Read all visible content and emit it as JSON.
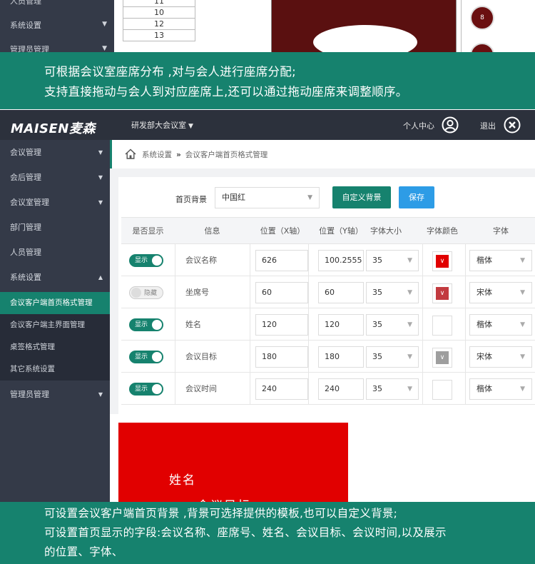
{
  "top_strip": {
    "sidebar_items": [
      {
        "label": "人员管理",
        "has_arrow": false
      },
      {
        "label": "系统设置",
        "has_arrow": true
      },
      {
        "label": "管理员管理",
        "has_arrow": true
      }
    ],
    "seat_numbers": [
      "11",
      "10",
      "12",
      "13"
    ],
    "seats": [
      "8",
      ""
    ]
  },
  "caption_top": [
    "可根据会议室座席分布 ,对与会人进行座席分配;",
    "支持直接拖动与会人到对应座席上,还可以通过拖动座席来调整顺序。"
  ],
  "caption_bottom": [
    "可设置会议客户端首页背景 ,背景可选择提供的模板,也可以自定义背景;",
    "可设置首页显示的字段:会议名称、座席号、姓名、会议目标、会议时间,以及展示",
    "的位置、字体、"
  ],
  "header": {
    "logo": "MAISEN麦森",
    "room_select": "研发部大会议室",
    "personal_center": "个人中心",
    "logout": "退出"
  },
  "sidebar": {
    "items": [
      {
        "label": "会议管理",
        "arrow": "▼"
      },
      {
        "label": "会后管理",
        "arrow": "▼"
      },
      {
        "label": "会议室管理",
        "arrow": "▼"
      },
      {
        "label": "部门管理",
        "arrow": ""
      },
      {
        "label": "人员管理",
        "arrow": ""
      },
      {
        "label": "系统设置",
        "arrow": "▲"
      }
    ],
    "subitems": [
      {
        "label": "会议客户端首页格式管理",
        "active": true
      },
      {
        "label": "会议客户端主界面管理",
        "active": false
      },
      {
        "label": "桌签格式管理",
        "active": false
      },
      {
        "label": "其它系统设置",
        "active": false
      }
    ],
    "last_item": {
      "label": "管理员管理",
      "arrow": "▼"
    }
  },
  "breadcrumb": {
    "root": "系统设置",
    "separator": "»",
    "current": "会议客户端首页格式管理"
  },
  "controls": {
    "bg_label": "首页背景",
    "bg_value": "中国红",
    "custom_bg_button": "自定义背景",
    "save_button": "保存"
  },
  "table": {
    "headers": [
      "是否显示",
      "信息",
      "位置（X轴）",
      "位置（Y轴）",
      "字体大小",
      "字体颜色",
      "字体"
    ],
    "rows": [
      {
        "show": true,
        "toggle_label": "显示",
        "info": "会议名称",
        "x": "626",
        "y": "100.2555",
        "size": "35",
        "color": "#e10000",
        "font": "楷体"
      },
      {
        "show": false,
        "toggle_label": "隐藏",
        "info": "坐席号",
        "x": "60",
        "y": "60",
        "size": "35",
        "color": "#c23a3f",
        "font": "宋体"
      },
      {
        "show": true,
        "toggle_label": "显示",
        "info": "姓名",
        "x": "120",
        "y": "120",
        "size": "35",
        "color": "#ffffff",
        "font": "楷体"
      },
      {
        "show": true,
        "toggle_label": "显示",
        "info": "会议目标",
        "x": "180",
        "y": "180",
        "size": "35",
        "color": "#9e9e9e",
        "font": "宋体"
      },
      {
        "show": true,
        "toggle_label": "显示",
        "info": "会议时间",
        "x": "240",
        "y": "240",
        "size": "35",
        "color": "#ffffff",
        "font": "楷体"
      }
    ]
  },
  "preview": {
    "name_text": "姓名",
    "goal_text": "会议目标",
    "bg_color": "#e10000"
  },
  "colors": {
    "accent": "#16826e",
    "save_blue": "#2d9ce6",
    "topbar": "#2c313c",
    "sidebar": "#343a48"
  }
}
